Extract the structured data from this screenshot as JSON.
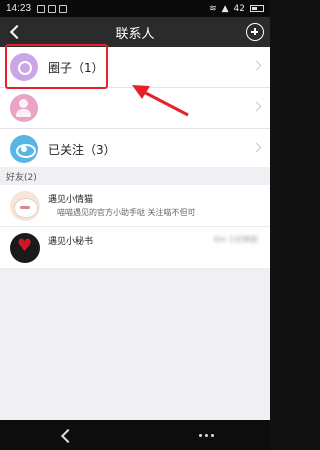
{
  "status_bar": {
    "time": "14:23",
    "battery": "42"
  },
  "header": {
    "title": "联系人"
  },
  "groups": [
    {
      "label": "圈子（1）",
      "icon": "circle-group-icon",
      "blurred": false
    },
    {
      "label": "",
      "icon": "people-icon",
      "blurred": true
    },
    {
      "label": "已关注（3）",
      "icon": "eye-icon",
      "blurred": false
    }
  ],
  "friends_section": {
    "title": "好友(2)"
  },
  "friends": [
    {
      "name": "遇见小情猫",
      "meta": "",
      "tag": "",
      "message": "喵喵遇见的官方小助手哒 关注喵不但可"
    },
    {
      "name": "遇见小秘书",
      "meta": "0m 1分钟前",
      "tag": "",
      "message": ""
    }
  ],
  "colors": {
    "highlight": "#e8202a",
    "titlebar": "#2b2b2b"
  }
}
